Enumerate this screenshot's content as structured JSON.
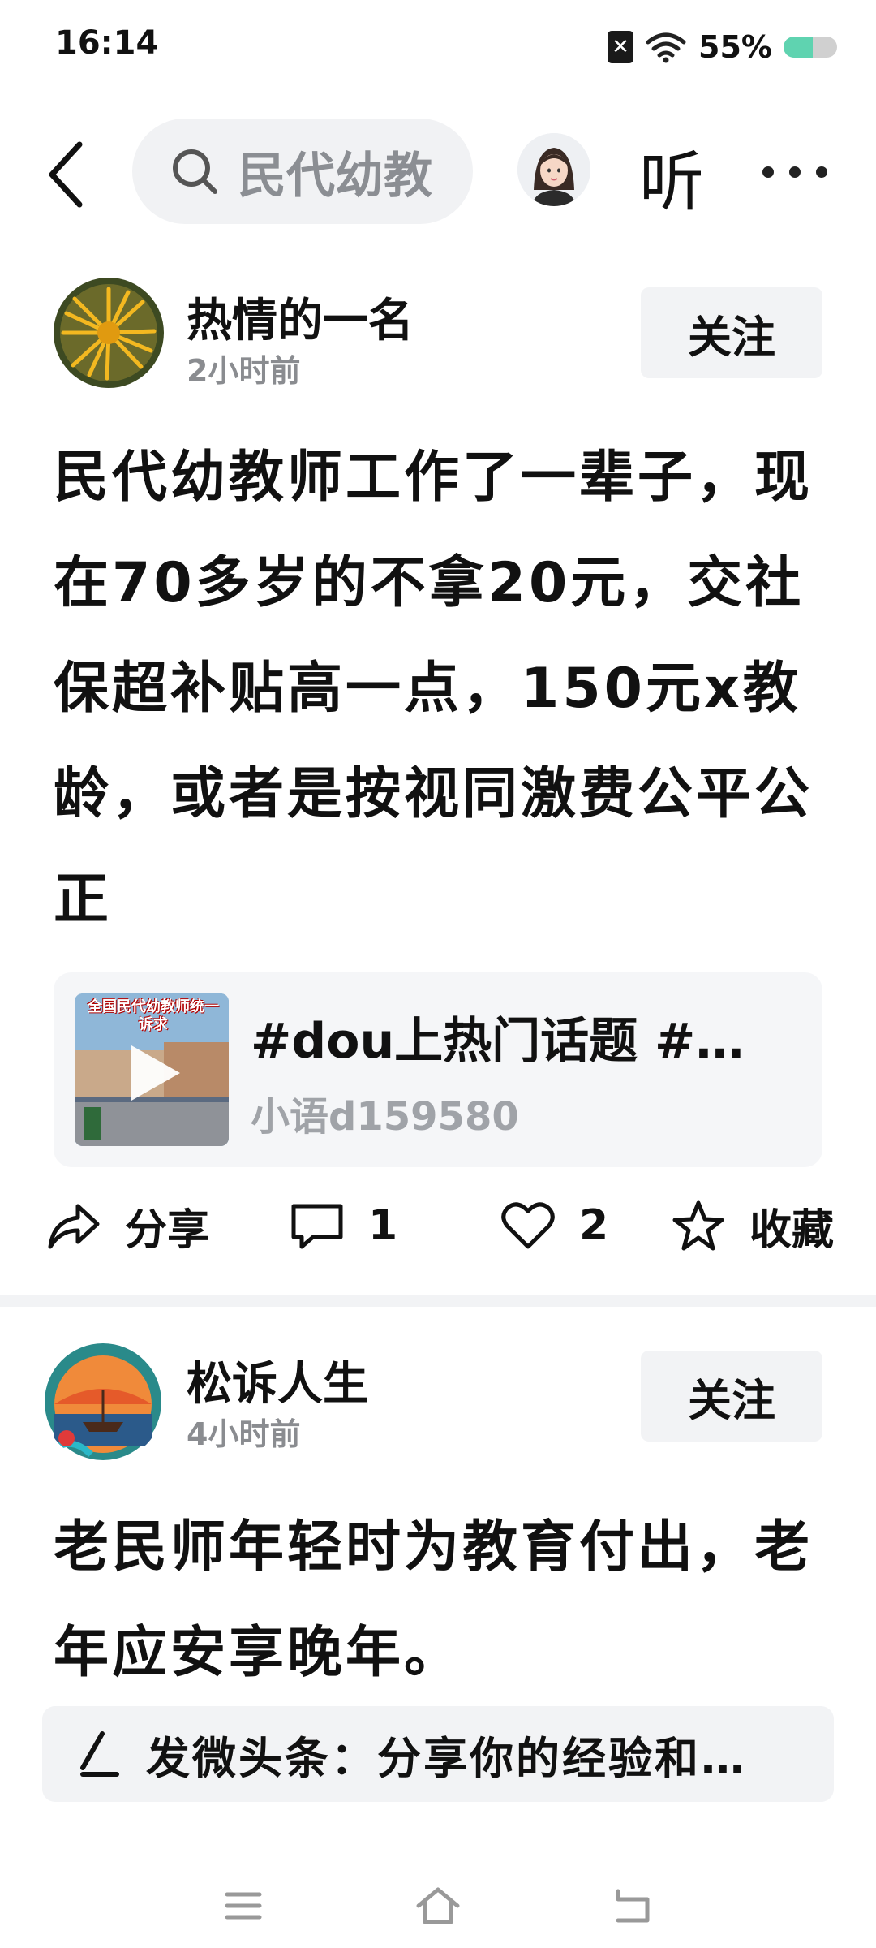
{
  "status_bar": {
    "time": "16:14",
    "battery": "55%",
    "battery_level": 0.55,
    "accent": "#5fd3b0"
  },
  "header": {
    "search_text": "民代幼教",
    "listen_label": "听",
    "icons": [
      "back-icon",
      "search-icon",
      "avatar",
      "more-icon"
    ]
  },
  "posts": [
    {
      "author": "热情的一名",
      "time": "2小时前",
      "follow_label": "关注",
      "text": "民代幼教师工作了一辈子，现在70多岁的不拿20元，交社保超补贴高一点，150元x教龄，或者是按视同激费公平公正",
      "video": {
        "caption": "全国民代幼教师统一诉求",
        "title": "#dou上热门话题 #…",
        "source": "小语d159580"
      },
      "actions": {
        "share_label": "分享",
        "comment_count": "1",
        "like_count": "2",
        "favorite_label": "收藏"
      }
    },
    {
      "author": "松诉人生",
      "time": "4小时前",
      "follow_label": "关注",
      "text": "老民师年轻时为教育付出，老年应安享晚年。"
    }
  ],
  "compose": {
    "placeholder": "发微头条：分享你的经验和…"
  },
  "nav": {
    "icons": [
      "menu-icon",
      "home-icon",
      "back-nav-icon"
    ]
  }
}
